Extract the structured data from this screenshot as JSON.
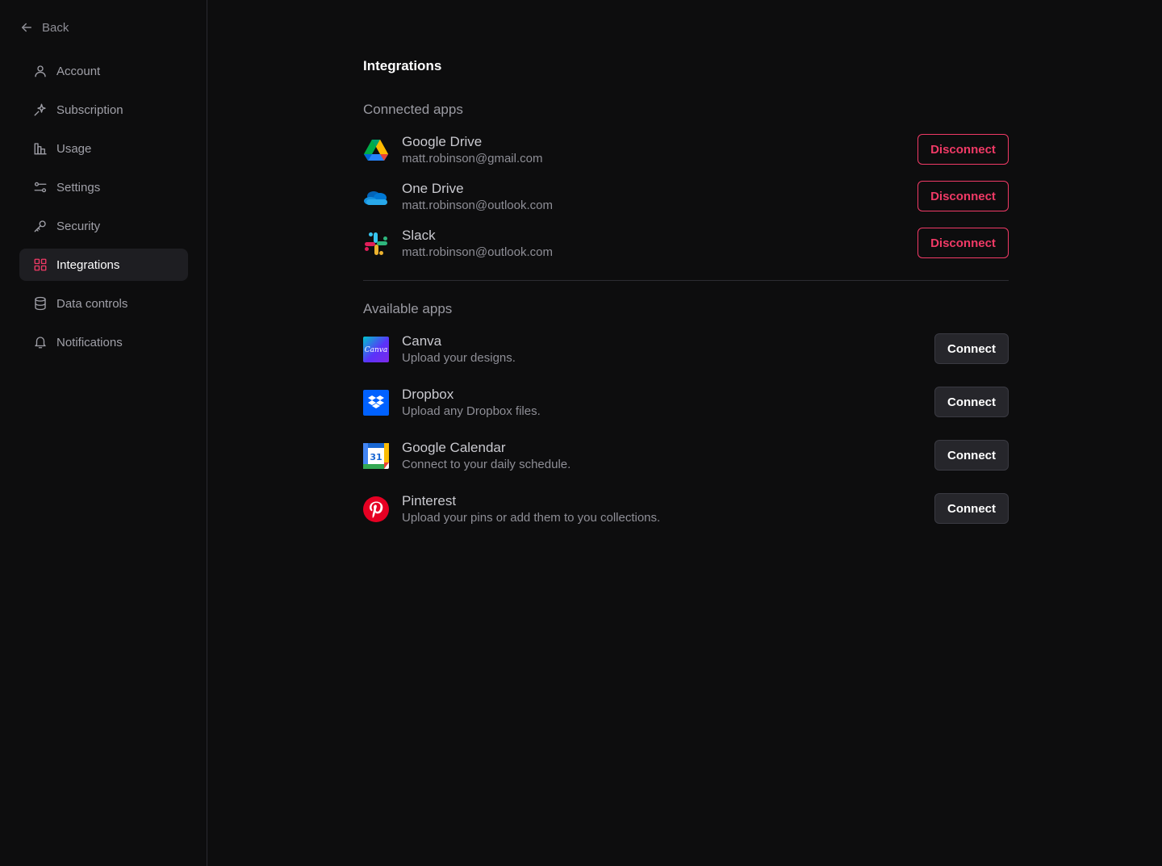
{
  "sidebar": {
    "back_label": "Back",
    "items": [
      {
        "label": "Account",
        "icon": "user-icon",
        "active": false
      },
      {
        "label": "Subscription",
        "icon": "sparkle-icon",
        "active": false
      },
      {
        "label": "Usage",
        "icon": "bar-chart-icon",
        "active": false
      },
      {
        "label": "Settings",
        "icon": "sliders-icon",
        "active": false
      },
      {
        "label": "Security",
        "icon": "key-icon",
        "active": false
      },
      {
        "label": "Integrations",
        "icon": "grid-icon",
        "active": true
      },
      {
        "label": "Data controls",
        "icon": "database-icon",
        "active": false
      },
      {
        "label": "Notifications",
        "icon": "bell-icon",
        "active": false
      }
    ]
  },
  "main": {
    "title": "Integrations",
    "connected": {
      "title": "Connected apps",
      "button_label": "Disconnect",
      "apps": [
        {
          "name": "Google Drive",
          "detail": "matt.robinson@gmail.com",
          "icon": "google-drive-icon"
        },
        {
          "name": "One Drive",
          "detail": "matt.robinson@outlook.com",
          "icon": "onedrive-icon"
        },
        {
          "name": "Slack",
          "detail": "matt.robinson@outlook.com",
          "icon": "slack-icon"
        }
      ]
    },
    "available": {
      "title": "Available apps",
      "button_label": "Connect",
      "apps": [
        {
          "name": "Canva",
          "detail": "Upload your designs.",
          "icon": "canva-icon",
          "logo_text": "Canva"
        },
        {
          "name": "Dropbox",
          "detail": "Upload any Dropbox files.",
          "icon": "dropbox-icon"
        },
        {
          "name": "Google Calendar",
          "detail": "Connect to your daily schedule.",
          "icon": "google-calendar-icon",
          "logo_text": "31"
        },
        {
          "name": "Pinterest",
          "detail": "Upload your pins or add them to you collections.",
          "icon": "pinterest-icon"
        }
      ]
    }
  },
  "colors": {
    "background": "#0d0d0e",
    "accent": "#f03a66",
    "active_nav_bg": "#1e1e22",
    "connect_bg": "#26262b"
  }
}
